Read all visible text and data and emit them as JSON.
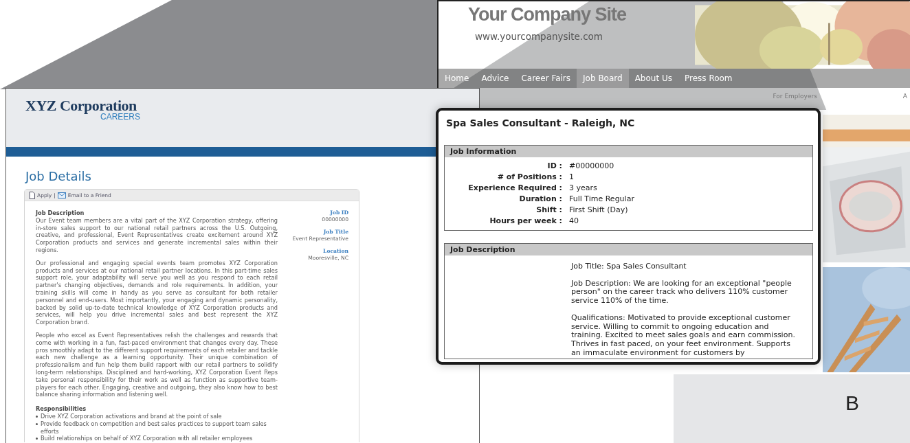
{
  "site_a": {
    "logo": "XYZ Corporation",
    "logo_subtitle": "CAREERS",
    "heading": "Job Details",
    "actions": [
      {
        "kind": "document",
        "label": "Apply"
      },
      {
        "kind": "envelope",
        "label": "Email to a Friend"
      }
    ],
    "action_separator": "|",
    "description_title": "Job Description",
    "paragraphs": [
      "Our Event team members are a vital part of the XYZ Corporation strategy, offering in-store sales support to our national retail partners across the U.S. Outgoing, creative, and professional, Event Representatives create excitement around XYZ Corporation products and services and generate incremental sales within their regions.",
      "Our professional and engaging special events team promotes XYZ Corporation products and services at our national retail partner locations. In this part-time sales support role, your adaptability will serve you well as you respond to each retail partner's changing objectives, demands and role requirements. In addition, your training skills will come in handy as you serve as consultant for both retailer personnel and end-users. Most importantly, your engaging and dynamic personality, backed by solid up-to-date technical knowledge of XYZ Corporation products and services, will help you drive incremental sales and best represent the XYZ Corporation brand.",
      "People who excel as Event Representatives relish the challenges and rewards that come with working in a fun, fast-paced environment that changes every day. These pros smoothly adapt to the different support requirements of each retailer and tackle each new challenge as a learning opportunity. Their unique combination of professionalism and fun help them build rapport with our retail partners to solidify long-term relationships. Disciplined and hard-working, XYZ Corporation Event Reps take personal responsibility for their work as well as function as supportive team-players for each other. Engaging, creative and outgoing, they also know how to best balance sharing information and listening well."
    ],
    "responsibilities_title": "Responsibilities",
    "responsibilities": [
      "Drive XYZ Corporation activations and brand at the point of sale",
      "Provide feedback on competition and best sales practices to support team sales efforts",
      "Build relationships on behalf of XYZ Corporation with all retailer employees"
    ],
    "facts": [
      {
        "label": "Job ID",
        "value": "00000000"
      },
      {
        "label": "Job Title",
        "value": "Event Representative"
      },
      {
        "label": "Location",
        "value": "Mooresville, NC"
      }
    ]
  },
  "site_b": {
    "title": "Your Company Site",
    "url": "www.yourcompanysite.com",
    "nav": [
      {
        "label": "Home",
        "selected": false
      },
      {
        "label": "Advice",
        "selected": false
      },
      {
        "label": "Career Fairs",
        "selected": false
      },
      {
        "label": "Job Board",
        "selected": true
      },
      {
        "label": "About Us",
        "selected": false
      },
      {
        "label": "Press Room",
        "selected": false
      }
    ],
    "utility_links": [
      "For Employers",
      "A"
    ]
  },
  "callout": {
    "title": "Spa Sales Consultant - Raleigh, NC",
    "info_heading": "Job Information",
    "fields": [
      {
        "label": "ID :",
        "value": "#00000000"
      },
      {
        "label": "# of Positions :",
        "value": "1"
      },
      {
        "label": "Experience Required :",
        "value": "3 years"
      },
      {
        "label": "Duration :",
        "value": "Full Time Regular"
      },
      {
        "label": "Shift :",
        "value": "First Shift (Day)"
      },
      {
        "label": "Hours per week :",
        "value": "40"
      }
    ],
    "description_heading": "Job Description",
    "description": [
      "Job Title: Spa Sales Consultant",
      "Job Description: We are looking for an exceptional \"people person\" on the career track who delivers 110% customer service 110% of the time.",
      "Qualifications: Motivated to provide exceptional customer service. Willing to commit to ongoing education and training. Excited to meet sales goals and earn commission. Thrives in fast paced, on your feet environment. Supports an immaculate environment for customers by"
    ]
  },
  "figure_label": "B"
}
